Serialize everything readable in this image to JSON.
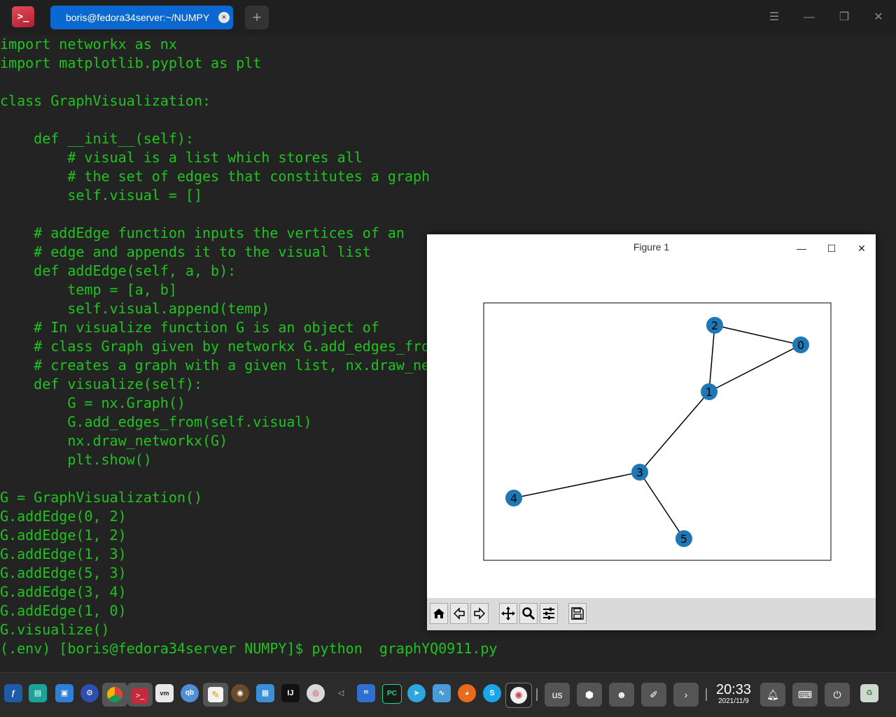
{
  "titlebar": {
    "app_icon_glyph": ">_",
    "tab_title": "boris@fedora34server:~/NUMPY",
    "tab_close_glyph": "×",
    "new_tab_glyph": "+",
    "menu_glyph": "☰",
    "minimize_glyph": "—",
    "maximize_glyph": "❐",
    "close_glyph": "✕"
  },
  "terminal": {
    "lines": [
      "import networkx as nx",
      "import matplotlib.pyplot as plt",
      "",
      "class GraphVisualization:",
      "",
      "    def __init__(self):",
      "        # visual is a list which stores all",
      "        # the set of edges that constitutes a graph",
      "        self.visual = []",
      "",
      "    # addEdge function inputs the vertices of an",
      "    # edge and appends it to the visual list",
      "    def addEdge(self, a, b):",
      "        temp = [a, b]",
      "        self.visual.append(temp)",
      "    # In visualize function G is an object of",
      "    # class Graph given by networkx G.add_edges_fro",
      "    # creates a graph with a given list, nx.draw_ne",
      "    def visualize(self):",
      "        G = nx.Graph()",
      "        G.add_edges_from(self.visual)",
      "        nx.draw_networkx(G)",
      "        plt.show()",
      "",
      "G = GraphVisualization()",
      "G.addEdge(0, 2)",
      "G.addEdge(1, 2)",
      "G.addEdge(1, 3)",
      "G.addEdge(5, 3)",
      "G.addEdge(3, 4)",
      "G.addEdge(1, 0)",
      "G.visualize()",
      "(.env) [boris@fedora34server NUMPY]$ python  graphYQ0911.py"
    ],
    "text_color": "#1ec31e",
    "background": "#232323"
  },
  "figure": {
    "title": "Figure 1",
    "minimize_glyph": "—",
    "maximize_glyph": "☐",
    "close_glyph": "✕",
    "graph": {
      "node_color": "#1f77b4",
      "nodes": [
        "0",
        "1",
        "2",
        "3",
        "4",
        "5"
      ],
      "edges": [
        [
          "0",
          "2"
        ],
        [
          "1",
          "2"
        ],
        [
          "1",
          "3"
        ],
        [
          "5",
          "3"
        ],
        [
          "3",
          "4"
        ],
        [
          "1",
          "0"
        ]
      ]
    },
    "toolbar": [
      "home-icon",
      "back-icon",
      "forward-icon",
      "pan-icon",
      "zoom-icon",
      "configure-subplots-icon",
      "save-icon"
    ]
  },
  "taskbar": {
    "keyboard_layout": "us",
    "time": "20:33",
    "date": "2021/11/9"
  }
}
